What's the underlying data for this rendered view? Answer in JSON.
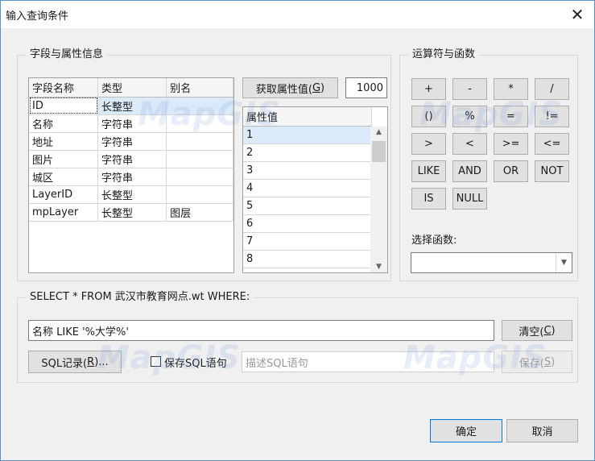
{
  "window": {
    "title": "输入查询条件",
    "close_glyph": "✕"
  },
  "fields_group": {
    "legend": "字段与属性信息",
    "headers": [
      "字段名称",
      "类型",
      "别名"
    ],
    "rows": [
      [
        "ID",
        "长整型",
        ""
      ],
      [
        "名称",
        "字符串",
        ""
      ],
      [
        "地址",
        "字符串",
        ""
      ],
      [
        "图片",
        "字符串",
        ""
      ],
      [
        "城区",
        "字符串",
        ""
      ],
      [
        "LayerID",
        "长整型",
        ""
      ],
      [
        "mpLayer",
        "长整型",
        "图层"
      ]
    ],
    "get_values_label": "获取属性值(",
    "get_values_key": "G",
    "get_values_suffix": ")",
    "count_value": "1000",
    "values_header": "属性值",
    "values": [
      "1",
      "2",
      "3",
      "4",
      "5",
      "6",
      "7",
      "8"
    ]
  },
  "operators_group": {
    "legend": "运算符与函数",
    "operators": [
      "+",
      "-",
      "*",
      "/",
      "()",
      "%",
      "=",
      "!=",
      ">",
      "<",
      ">=",
      "<=",
      "LIKE",
      "AND",
      "OR",
      "NOT",
      "IS",
      "NULL"
    ],
    "function_label": "选择函数:",
    "function_value": ""
  },
  "sql_group": {
    "legend": "SELECT * FROM 武汉市教育网点.wt WHERE:",
    "query_value": "名称 LIKE '%大学%'",
    "clear_label": "清空(",
    "clear_key": "C",
    "clear_suffix": ")",
    "history_label": "SQL记录(",
    "history_key": "R",
    "history_suffix": ")...",
    "save_sql_label": "保存SQL语句",
    "describe_placeholder": "描述SQL语句",
    "save_label": "保存(",
    "save_key": "S",
    "save_suffix": ")"
  },
  "footer": {
    "ok_label": "确定",
    "cancel_label": "取消"
  },
  "watermark_text": "MapGIS",
  "icons": {
    "close": "close-icon",
    "dropdown": "chevron-down-icon",
    "scroll_up": "chevron-up-icon",
    "scroll_down": "chevron-down-icon"
  }
}
